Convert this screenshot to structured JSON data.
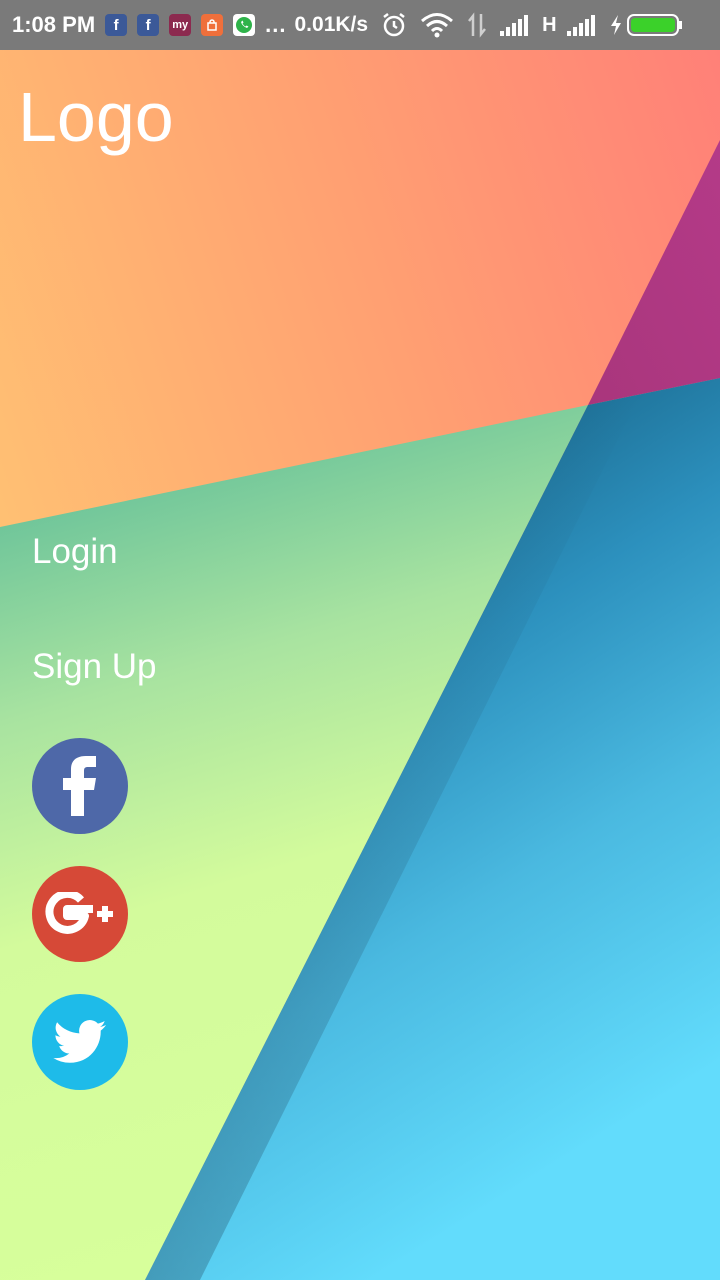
{
  "status_bar": {
    "time": "1:08 PM",
    "more": "...",
    "net_speed": "0.01K/s",
    "network_type": "H",
    "icons": [
      "facebook-notification-icon",
      "facebook-notification-icon",
      "myntra-notification-icon",
      "shopping-bag-notification-icon",
      "whatsapp-notification-icon",
      "alarm-icon",
      "wifi-icon",
      "data-transfer-icon",
      "signal-icon",
      "signal-icon",
      "charging-icon",
      "battery-icon"
    ]
  },
  "header": {
    "logo": "Logo"
  },
  "menu": {
    "login": "Login",
    "signup": "Sign Up"
  },
  "social": {
    "buttons": [
      "facebook-icon",
      "google-plus-icon",
      "twitter-icon"
    ],
    "colors": {
      "facebook": "#4e68a8",
      "google_plus": "#d64937",
      "twitter": "#1ebbe9"
    }
  }
}
